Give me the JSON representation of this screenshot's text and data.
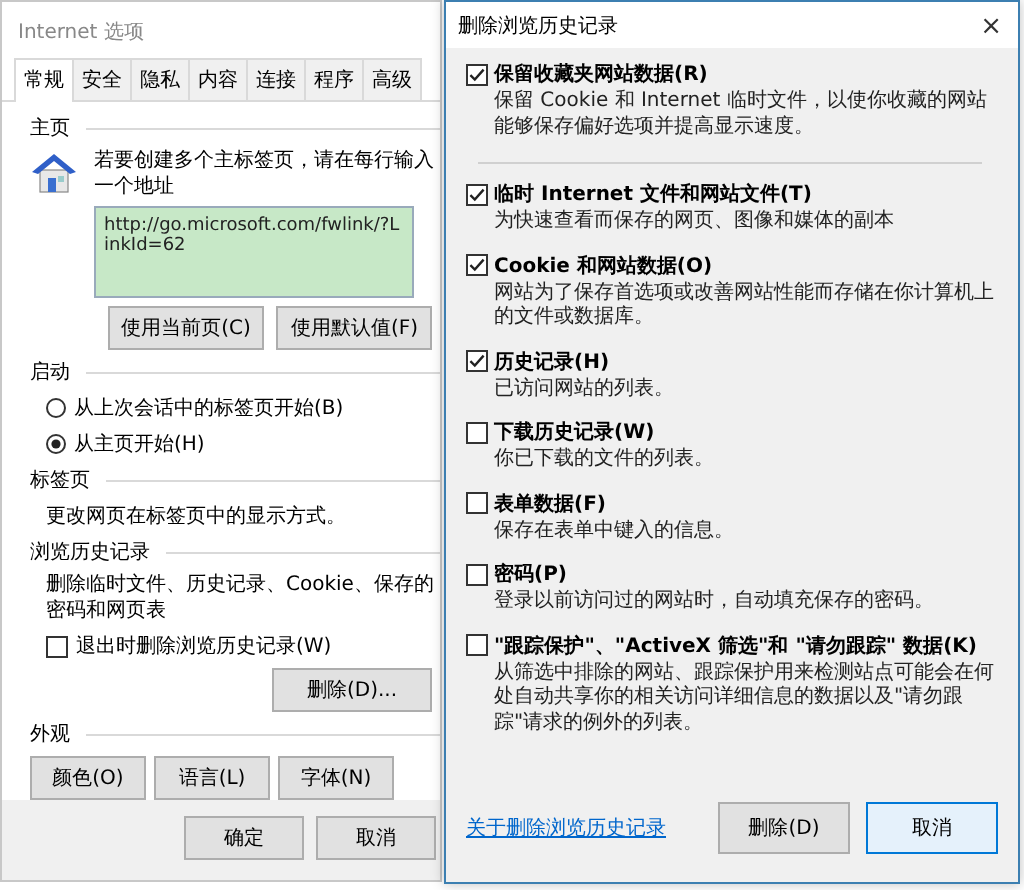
{
  "options_window": {
    "title": "Internet 选项",
    "tabs": [
      {
        "label": "常规",
        "selected": true
      },
      {
        "label": "安全",
        "selected": false
      },
      {
        "label": "隐私",
        "selected": false
      },
      {
        "label": "内容",
        "selected": false
      },
      {
        "label": "连接",
        "selected": false
      },
      {
        "label": "程序",
        "selected": false
      },
      {
        "label": "高级",
        "selected": false
      }
    ],
    "home_page": {
      "heading": "主页",
      "hint": "若要创建多个主标签页，请在每行输入一个地址",
      "url": "http://go.microsoft.com/fwlink/?LinkId=62",
      "buttons": [
        "使用当前页(C)",
        "使用默认值(F)"
      ]
    },
    "startup": {
      "heading": "启动",
      "options": [
        {
          "label": "从上次会话中的标签页开始(B)",
          "selected": false
        },
        {
          "label": "从主页开始(H)",
          "selected": true
        }
      ]
    },
    "tabs_section": {
      "heading": "标签页",
      "description": "更改网页在标签页中的显示方式。"
    },
    "history": {
      "heading": "浏览历史记录",
      "description": "删除临时文件、历史记录、Cookie、保存的密码和网页表",
      "delete_on_exit": {
        "label": "退出时删除浏览历史记录(W)",
        "checked": false
      },
      "button": "删除(D)..."
    },
    "appearance": {
      "heading": "外观",
      "buttons": [
        "颜色(O)",
        "语言(L)",
        "字体(N)"
      ]
    },
    "footer_buttons": [
      "确定",
      "取消"
    ]
  },
  "delete_dialog": {
    "title": "删除浏览历史记录",
    "close": "×",
    "items": [
      {
        "label": "保留收藏夹网站数据(R)",
        "description": "保留 Cookie 和 Internet 临时文件，以使你收藏的网站能够保存偏好选项并提高显示速度。",
        "checked": true,
        "separator_after": true
      },
      {
        "label": "临时 Internet 文件和网站文件(T)",
        "description": "为快速查看而保存的网页、图像和媒体的副本",
        "checked": true,
        "separator_after": false
      },
      {
        "label": "Cookie 和网站数据(O)",
        "description": "网站为了保存首选项或改善网站性能而存储在你计算机上的文件或数据库。",
        "checked": true,
        "separator_after": false
      },
      {
        "label": "历史记录(H)",
        "description": "已访问网站的列表。",
        "checked": true,
        "separator_after": false
      },
      {
        "label": "下载历史记录(W)",
        "description": "你已下载的文件的列表。",
        "checked": false,
        "separator_after": false
      },
      {
        "label": "表单数据(F)",
        "description": "保存在表单中键入的信息。",
        "checked": false,
        "separator_after": false
      },
      {
        "label": "密码(P)",
        "description": "登录以前访问过的网站时，自动填充保存的密码。",
        "checked": false,
        "separator_after": false
      },
      {
        "label": "\"跟踪保护\"、\"ActiveX 筛选\"和 \"请勿跟踪\" 数据(K)",
        "description": "从筛选中排除的网站、跟踪保护用来检测站点可能会在何处自动共享你的相关访问详细信息的数据以及\"请勿跟踪\"请求的例外的列表。",
        "checked": false,
        "separator_after": false
      }
    ],
    "link": "关于删除浏览历史记录",
    "buttons": [
      {
        "label": "删除(D)",
        "focused": false
      },
      {
        "label": "取消",
        "focused": true
      }
    ]
  }
}
